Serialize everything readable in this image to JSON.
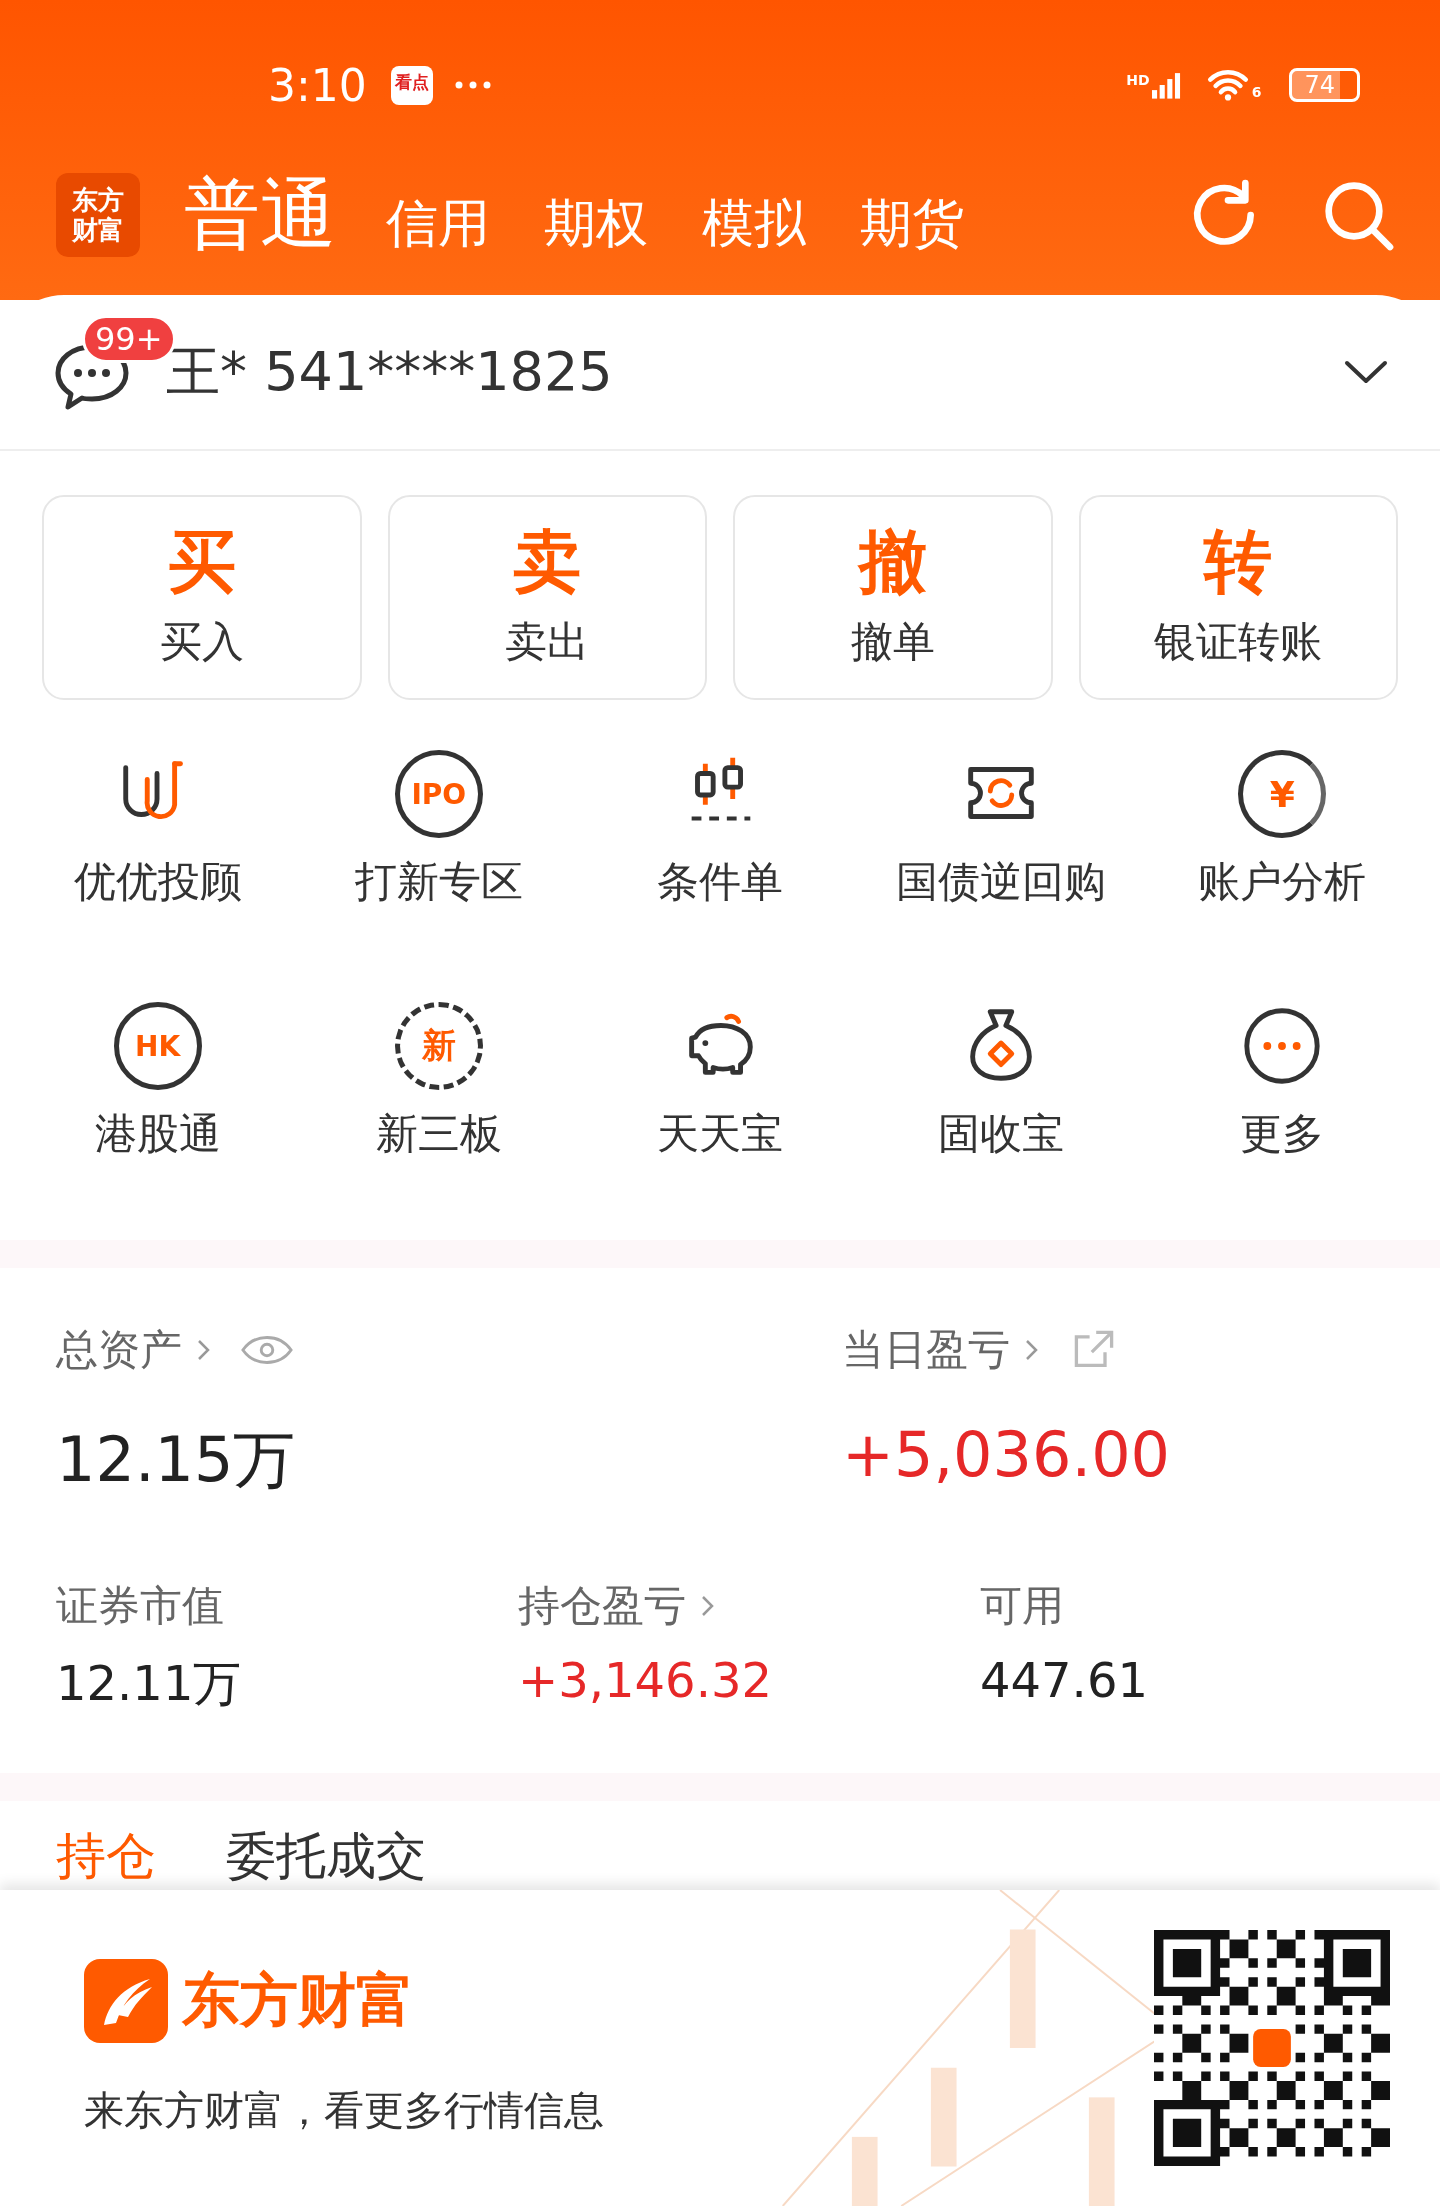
{
  "status_bar": {
    "time": "3:10",
    "app_badge": "看点",
    "network": "HD",
    "wifi_gen": "6",
    "battery": "74"
  },
  "header": {
    "logo_lines": [
      "东方",
      "财富"
    ],
    "tabs": [
      {
        "label": "普通",
        "selected": true
      },
      {
        "label": "信用",
        "selected": false
      },
      {
        "label": "期权",
        "selected": false
      },
      {
        "label": "模拟",
        "selected": false
      },
      {
        "label": "期货",
        "selected": false
      }
    ]
  },
  "account": {
    "badge": "99+",
    "name": "王* 541****1825"
  },
  "actions": [
    {
      "glyph": "买",
      "label": "买入"
    },
    {
      "glyph": "卖",
      "label": "卖出"
    },
    {
      "glyph": "撤",
      "label": "撤单"
    },
    {
      "glyph": "转",
      "label": "银证转账"
    }
  ],
  "shortcuts": [
    {
      "kind": "uu",
      "label": "优优投顾"
    },
    {
      "kind": "ipo",
      "icon_text": "IPO",
      "label": "打新专区"
    },
    {
      "kind": "candles",
      "label": "条件单"
    },
    {
      "kind": "ticket",
      "label": "国债逆回购"
    },
    {
      "kind": "yen",
      "icon_text": "¥",
      "label": "账户分析"
    },
    {
      "kind": "hk",
      "icon_text": "HK",
      "label": "港股通"
    },
    {
      "kind": "cycle",
      "icon_text": "新",
      "label": "新三板"
    },
    {
      "kind": "pig",
      "label": "天天宝"
    },
    {
      "kind": "bag",
      "label": "固收宝"
    },
    {
      "kind": "more",
      "label": "更多"
    }
  ],
  "assets": {
    "total": {
      "label": "总资产",
      "value": "12.15万",
      "color": "#222222"
    },
    "daily": {
      "label": "当日盈亏",
      "value": "+5,036.00",
      "color": "#e62828"
    },
    "stats": [
      {
        "label": "证券市值",
        "value": "12.11万",
        "color": "#222222",
        "arrow": false
      },
      {
        "label": "持仓盈亏",
        "value": "+3,146.32",
        "color": "#e62828",
        "arrow": true
      },
      {
        "label": "可用",
        "value": "447.61",
        "color": "#222222",
        "arrow": false
      }
    ]
  },
  "holdings_tabs": [
    {
      "label": "持仓",
      "selected": true
    },
    {
      "label": "委托成交",
      "selected": false
    }
  ],
  "banner": {
    "brand": "东方财富",
    "slogan": "来东方财富，看更多行情信息"
  }
}
